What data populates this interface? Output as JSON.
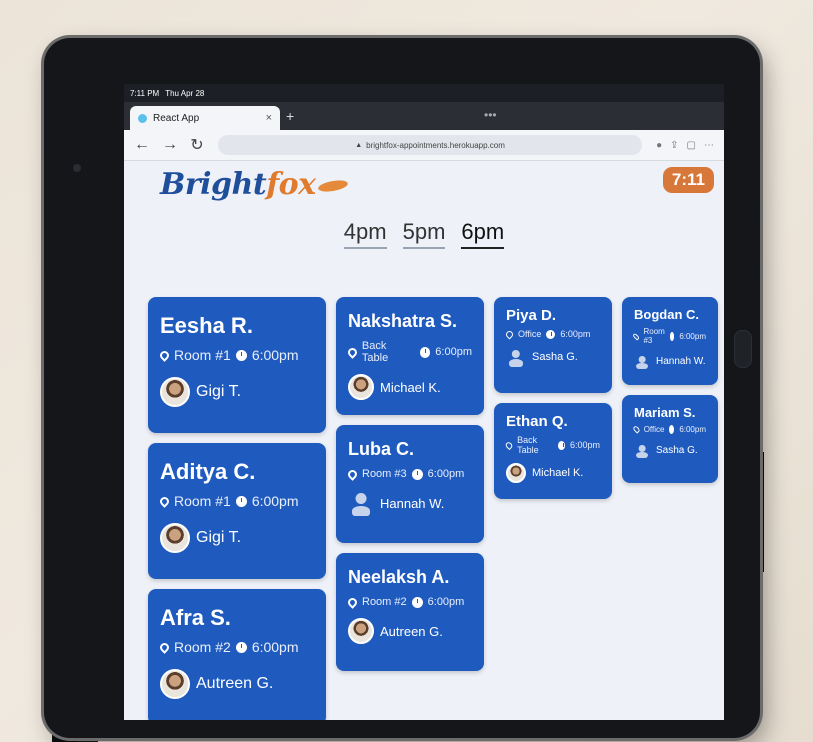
{
  "statusbar": {
    "time": "7:11 PM",
    "date": "Thu Apr 28"
  },
  "browser": {
    "tab_title": "React App",
    "tab_close": "×",
    "new_tab": "+",
    "url": "brightfox-appointments.herokuapp.com",
    "back_icon": "back-arrow-icon",
    "forward_icon": "forward-arrow-icon",
    "reload_icon": "reload-icon"
  },
  "app": {
    "logo_part1": "Bright",
    "logo_part2": "fox",
    "clock": "7:11",
    "times": [
      "4pm",
      "5pm",
      "6pm"
    ],
    "active_time": "6pm"
  },
  "appointments": [
    [
      {
        "name": "Eesha R.",
        "room": "Room #1",
        "time": "6:00pm",
        "staff": "Gigi T.",
        "photo": true
      },
      {
        "name": "Aditya C.",
        "room": "Room #1",
        "time": "6:00pm",
        "staff": "Gigi T.",
        "photo": true
      },
      {
        "name": "Afra S.",
        "room": "Room #2",
        "time": "6:00pm",
        "staff": "Autreen G.",
        "photo": true
      }
    ],
    [
      {
        "name": "Nakshatra S.",
        "room": "Back Table",
        "time": "6:00pm",
        "staff": "Michael K.",
        "photo": true
      },
      {
        "name": "Luba C.",
        "room": "Room #3",
        "time": "6:00pm",
        "staff": "Hannah W.",
        "photo": false
      },
      {
        "name": "Neelaksh A.",
        "room": "Room #2",
        "time": "6:00pm",
        "staff": "Autreen G.",
        "photo": true
      }
    ],
    [
      {
        "name": "Piya D.",
        "room": "Office",
        "time": "6:00pm",
        "staff": "Sasha G.",
        "photo": false
      },
      {
        "name": "Ethan Q.",
        "room": "Back Table",
        "time": "6:00pm",
        "staff": "Michael K.",
        "photo": true
      }
    ],
    [
      {
        "name": "Bogdan C.",
        "room": "Room #3",
        "time": "6:00pm",
        "staff": "Hannah W.",
        "photo": false
      },
      {
        "name": "Mariam S.",
        "room": "Office",
        "time": "6:00pm",
        "staff": "Sasha G.",
        "photo": false
      }
    ]
  ],
  "colors": {
    "card": "#1f5bbf",
    "clock_badge": "#d8773a",
    "logo_blue": "#1f4e9a",
    "logo_orange": "#e07a2c"
  }
}
